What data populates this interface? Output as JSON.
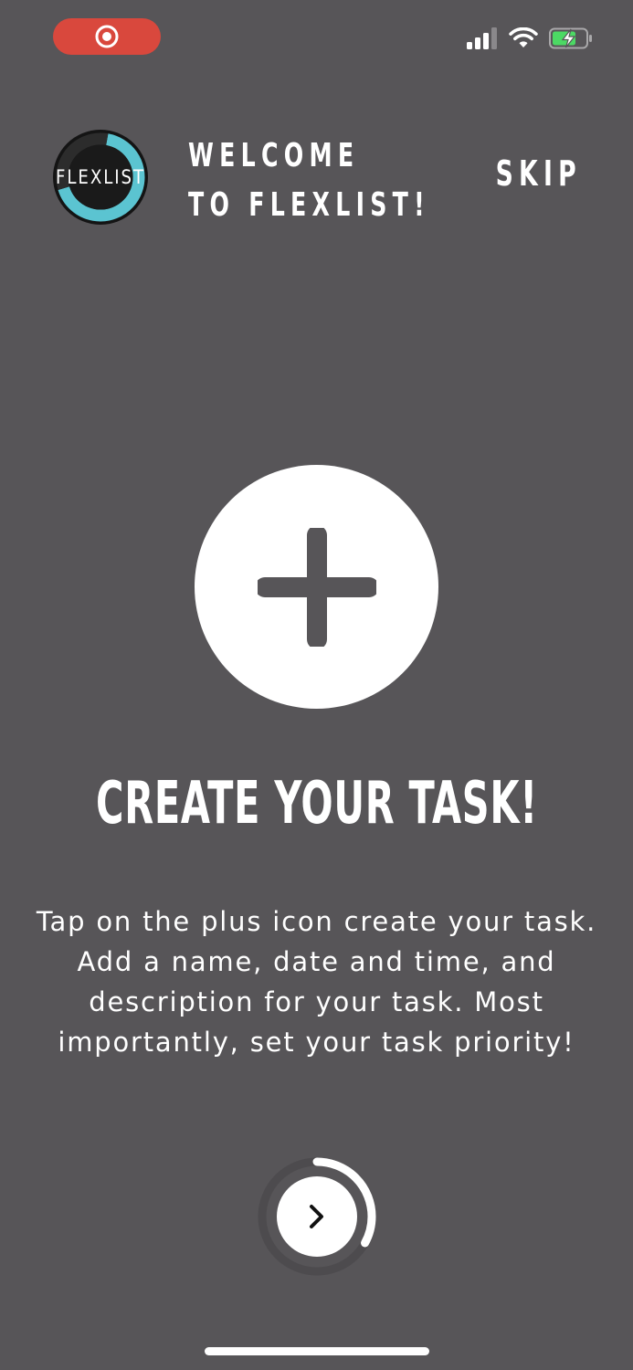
{
  "status_bar": {
    "record_icon": "screen-record-icon",
    "signal_icon": "cellular-signal-icon",
    "wifi_icon": "wifi-icon",
    "battery_icon": "battery-charging-icon",
    "record_color": "#d9483d",
    "battery_color": "#4cd964"
  },
  "header": {
    "logo_text": "FLEXLIST",
    "welcome_line1": "WELCOME",
    "welcome_line2": "TO FLEXLIST!",
    "skip_label": "SKIP",
    "logo_accent": "#5bc4d1"
  },
  "main": {
    "plus_icon": "plus-icon",
    "title": "CREATE YOUR TASK!",
    "description": "Tap on the plus icon create your task. Add a name, date and time, and description for your task. Most importantly, set your task priority!"
  },
  "footer": {
    "next_icon": "chevron-right-icon",
    "progress": 0.33
  },
  "colors": {
    "background": "#575558",
    "text": "#ffffff"
  }
}
